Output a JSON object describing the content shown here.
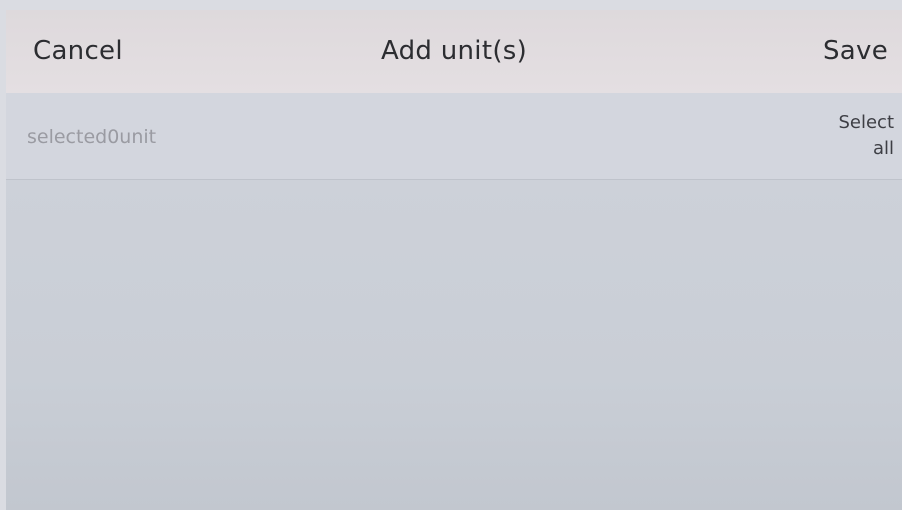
{
  "header": {
    "cancel_label": "Cancel",
    "title": "Add unit(s)",
    "save_label": "Save"
  },
  "selection": {
    "count_text": "selected0unit",
    "select_all_line1": "Select",
    "select_all_line2": "all"
  },
  "colors": {
    "header_bg": "#e2dde0",
    "row_bg": "#d3d6de",
    "body_bg": "#c9ced6",
    "text_dark": "#2c2d31",
    "text_muted": "#9a9ba2"
  }
}
